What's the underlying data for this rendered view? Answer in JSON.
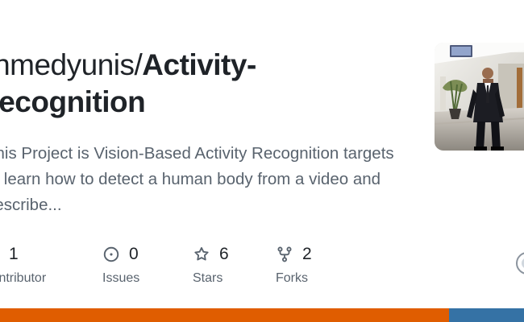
{
  "repo": {
    "owner": "ahmedyunis",
    "slash": "/",
    "name": "Activity-Recognition",
    "description": "This Project is Vision-Based Activity Recognition targets to learn how to detect a human body from a video and describe..."
  },
  "stats": [
    {
      "icon": "people-icon",
      "count": "1",
      "label": "Contributor"
    },
    {
      "icon": "issue-icon",
      "count": "0",
      "label": "Issues"
    },
    {
      "icon": "star-icon",
      "count": "6",
      "label": "Stars"
    },
    {
      "icon": "fork-icon",
      "count": "2",
      "label": "Forks"
    }
  ],
  "avatar": {
    "kind": "profile-photo"
  },
  "colors": {
    "title": "#1f2328",
    "muted": "#59636e",
    "language_primary": "#e05d00",
    "language_secondary": "#3572a5"
  },
  "languages": [
    {
      "color": "#e05d00",
      "share": 0.857
    },
    {
      "color": "#3572a5",
      "share": 0.143
    }
  ]
}
